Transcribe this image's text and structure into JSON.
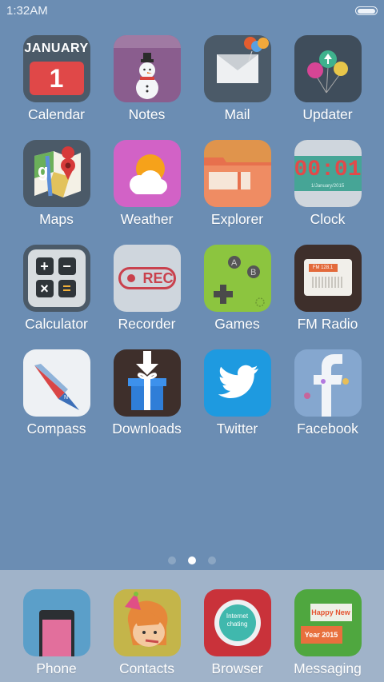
{
  "status_bar": {
    "time": "1:32AM",
    "battery_icon": "battery-full-icon"
  },
  "apps": [
    {
      "label": "Calendar",
      "icon": "calendar-icon",
      "month": "JANUARY",
      "day": "1"
    },
    {
      "label": "Notes",
      "icon": "snowman-notes-icon"
    },
    {
      "label": "Mail",
      "icon": "envelope-icon"
    },
    {
      "label": "Updater",
      "icon": "balloons-icon"
    },
    {
      "label": "Maps",
      "icon": "map-pin-icon"
    },
    {
      "label": "Weather",
      "icon": "sun-cloud-icon"
    },
    {
      "label": "Explorer",
      "icon": "folder-icon"
    },
    {
      "label": "Clock",
      "icon": "digital-clock-icon",
      "time": "00:01",
      "date": "1/January/2015"
    },
    {
      "label": "Calculator",
      "icon": "calculator-icon"
    },
    {
      "label": "Recorder",
      "icon": "rec-icon",
      "rec_text": "REC"
    },
    {
      "label": "Games",
      "icon": "gamepad-icon"
    },
    {
      "label": "FM Radio",
      "icon": "radio-icon",
      "freq": "FM 128.1"
    },
    {
      "label": "Compass",
      "icon": "compass-needle-icon"
    },
    {
      "label": "Downloads",
      "icon": "gift-download-icon"
    },
    {
      "label": "Twitter",
      "icon": "twitter-bird-icon"
    },
    {
      "label": "Facebook",
      "icon": "facebook-f-icon"
    }
  ],
  "page_indicator": {
    "count": 3,
    "active": 2
  },
  "dock": [
    {
      "label": "Phone",
      "icon": "phone-icon"
    },
    {
      "label": "Contacts",
      "icon": "contact-face-icon"
    },
    {
      "label": "Browser",
      "icon": "internet-globe-icon",
      "text1": "Internet",
      "text2": "chating"
    },
    {
      "label": "Messaging",
      "icon": "message-bubbles-icon",
      "text1": "Happy New",
      "text2": "Year 2015"
    }
  ]
}
